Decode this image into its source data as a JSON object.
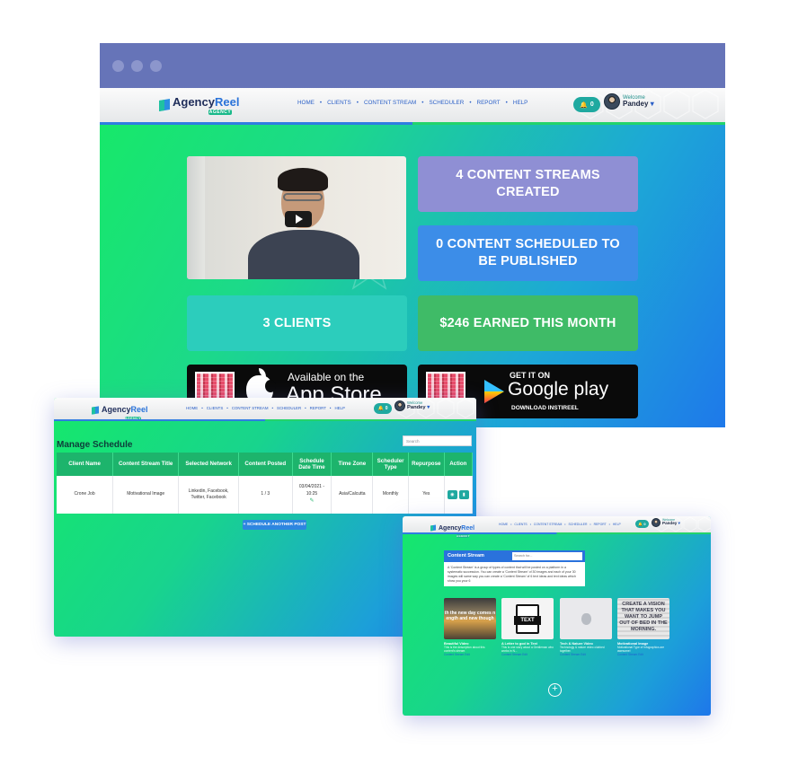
{
  "brand": {
    "name_a": "Agency",
    "name_b": "Reel",
    "sub": "AGENCY"
  },
  "nav": {
    "items": [
      "HOME",
      "CLIENTS",
      "CONTENT STREAM",
      "SCHEDULER",
      "REPORT",
      "HELP"
    ],
    "dot": "•",
    "notification_count": "0",
    "welcome": "Welcome",
    "username": "Pandey",
    "caret": "▾"
  },
  "colors": {
    "navy": "#1f2d5a",
    "accent_blue": "#2a73d9",
    "teal": "#1fa9a0",
    "green": "#17e86a"
  },
  "main": {
    "stats": {
      "streams": "4 CONTENT STREAMS CREATED",
      "scheduled": "0 CONTENT SCHEDULED TO BE PUBLISHED",
      "clients": "3 CLIENTS",
      "earned": "$246 EARNED THIS MONTH"
    },
    "appstore": {
      "small": "Available on the",
      "big": "App Store"
    },
    "googleplay": {
      "small": "GET IT ON",
      "big": "Google play",
      "sub": "DOWNLOAD INSTIREEL"
    }
  },
  "schedule": {
    "title": "Manage Schedule",
    "search_placeholder": "Search",
    "headers": [
      "Client Name",
      "Content Stream Title",
      "Selected Network",
      "Content Posted",
      "Schedule Date Time",
      "Time Zone",
      "Scheduler Type",
      "Repurpose",
      "Action"
    ],
    "row": {
      "client": "Crone Job",
      "stream": "Motivational Image",
      "network": "Linkedin, Facebook, Twitter, Facebook",
      "posted": "1 / 3",
      "datetime": "03/04/2021 - 10:25",
      "timezone": "Asia/Calcutta",
      "type": "Monthly",
      "repurpose": "Yes"
    },
    "button": "+ SCHEDULE ANOTHER POST"
  },
  "stream": {
    "title": "Content Stream",
    "search_placeholder": "Search for...",
    "description": "A 'Content Stream' is a group of types of content that will be posted on a platform in a systematic succession. You can create a 'Content Stream' of 30 images and each of your 30 images will same way you can create a 'Content Stream' of 6 text ideas and text ideas which show you your 6",
    "cards": [
      {
        "image_text": "th the new day comes n ength and new though",
        "title": "Beautiful Video",
        "sub": "This is the description about this content's stream",
        "link": "Content Stream Edit"
      },
      {
        "image_text": "TEXT",
        "title": "A Letter to god in Text",
        "sub": "This is one story about a Gentleman who works in N...",
        "link": "Content Stream Edit"
      },
      {
        "image_text": "",
        "title": "Tech & Nature Video",
        "sub": "Technology & nature video clubbed together.",
        "link": "Content Stream Edit"
      },
      {
        "image_text": "CREATE A VISION THAT MAKES YOU WANT TO JUMP OUT OF BED IN THE MORNING.",
        "title": "Motivational Image",
        "sub": "Motivational Type of Infographics are awesome!",
        "link": "Content Stream Edit"
      }
    ],
    "add_icon": "+"
  }
}
